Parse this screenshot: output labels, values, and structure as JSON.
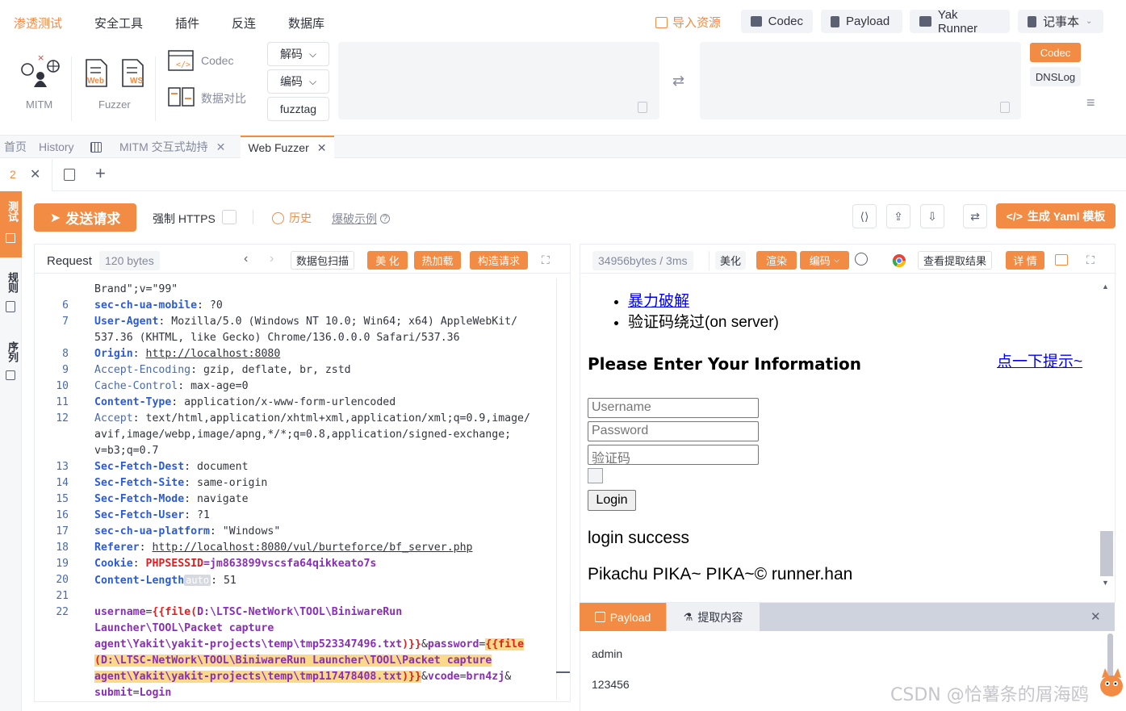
{
  "topnav": {
    "items": [
      "渗透测试",
      "安全工具",
      "插件",
      "反连",
      "数据库"
    ],
    "import_label": "导入资源",
    "buttons": [
      "Codec",
      "Payload",
      "Yak Runner",
      "记事本"
    ]
  },
  "toolbar": {
    "mitm_label": "MITM",
    "fuzzer_label": "Fuzzer",
    "web_label": "Web",
    "ws_label": "WS",
    "codec_label": "Codec",
    "compare_label": "数据对比",
    "decode_label": "解码",
    "encode_label": "编码",
    "fuzztag_label": "fuzztag",
    "right_tabs": [
      "Codec",
      "DNSLog"
    ]
  },
  "page_tabs": [
    "首页",
    "History",
    "MITM 交互式劫持",
    "Web Fuzzer"
  ],
  "sub_tab": {
    "number": "2"
  },
  "left_strip": [
    "测试",
    "规则",
    "序列"
  ],
  "actions": {
    "send": "发送请求",
    "force_https": "强制 HTTPS",
    "history": "历史",
    "brute_example": "爆破示例",
    "yaml": "生成 Yaml 模板"
  },
  "request": {
    "title": "Request",
    "size": "120 bytes",
    "buttons": [
      "数据包扫描",
      "美 化",
      "热加载",
      "构造请求"
    ],
    "lines": [
      {
        "n": "",
        "segs": [
          {
            "t": "Brand\";v=\"99\""
          }
        ]
      },
      {
        "n": "6",
        "segs": [
          {
            "t": "sec-ch-ua-mobile",
            "c": "k"
          },
          {
            "t": ": ?0"
          }
        ]
      },
      {
        "n": "7",
        "segs": [
          {
            "t": "User-Agent",
            "c": "k"
          },
          {
            "t": ": Mozilla/5.0 (Windows NT 10.0; Win64; x64) AppleWebKit/"
          }
        ]
      },
      {
        "n": "",
        "segs": [
          {
            "t": "537.36 (KHTML, like Gecko) Chrome/136.0.0.0 Safari/537.36"
          }
        ]
      },
      {
        "n": "8",
        "segs": [
          {
            "t": "Origin",
            "c": "k"
          },
          {
            "t": ": "
          },
          {
            "t": "http://localhost:8080",
            "c": "ul"
          }
        ]
      },
      {
        "n": "9",
        "segs": [
          {
            "t": "Accept-Encoding",
            "c": "k2"
          },
          {
            "t": ": gzip, deflate, br, zstd"
          }
        ]
      },
      {
        "n": "10",
        "segs": [
          {
            "t": "Cache-Control",
            "c": "k2"
          },
          {
            "t": ": max-age=0"
          }
        ]
      },
      {
        "n": "11",
        "segs": [
          {
            "t": "Content-Type",
            "c": "k"
          },
          {
            "t": ": application/x-www-form-urlencoded"
          }
        ]
      },
      {
        "n": "12",
        "segs": [
          {
            "t": "Accept",
            "c": "k2"
          },
          {
            "t": ": text/html,application/xhtml+xml,application/xml;q=0.9,image/"
          }
        ]
      },
      {
        "n": "",
        "segs": [
          {
            "t": "avif,image/webp,image/apng,*/*;q=0.8,application/signed-exchange;"
          }
        ]
      },
      {
        "n": "",
        "segs": [
          {
            "t": "v=b3;q=0.7"
          }
        ]
      },
      {
        "n": "13",
        "segs": [
          {
            "t": "Sec-Fetch-Dest",
            "c": "k"
          },
          {
            "t": ": document"
          }
        ]
      },
      {
        "n": "14",
        "segs": [
          {
            "t": "Sec-Fetch-Site",
            "c": "k"
          },
          {
            "t": ": same-origin"
          }
        ]
      },
      {
        "n": "15",
        "segs": [
          {
            "t": "Sec-Fetch-Mode",
            "c": "k"
          },
          {
            "t": ": navigate"
          }
        ]
      },
      {
        "n": "16",
        "segs": [
          {
            "t": "Sec-Fetch-User",
            "c": "k"
          },
          {
            "t": ": ?1"
          }
        ]
      },
      {
        "n": "17",
        "segs": [
          {
            "t": "sec-ch-ua-platform",
            "c": "k"
          },
          {
            "t": ": \"Windows\""
          }
        ]
      },
      {
        "n": "18",
        "segs": [
          {
            "t": "Referer",
            "c": "k"
          },
          {
            "t": ": "
          },
          {
            "t": "http://localhost:8080/vul/burteforce/bf_server.php",
            "c": "ul"
          }
        ]
      },
      {
        "n": "19",
        "segs": [
          {
            "t": "Cookie",
            "c": "k"
          },
          {
            "t": ": "
          },
          {
            "t": "PHPSESSID",
            "c": "ph"
          },
          {
            "t": "=jm863899vscsfa64qikkeato7s",
            "c": "sv"
          }
        ]
      },
      {
        "n": "20",
        "segs": [
          {
            "t": "Content-Length",
            "c": "k"
          },
          {
            "t": "auto",
            "c": "tagauto"
          },
          {
            "t": ": 51"
          }
        ]
      },
      {
        "n": "21",
        "segs": [
          {
            "t": ""
          }
        ]
      },
      {
        "n": "22",
        "segs": [
          {
            "t": "username",
            "c": "pk"
          },
          {
            "t": "="
          },
          {
            "t": "{{file(",
            "c": "ph"
          },
          {
            "t": "D:\\LTSC-NetWork\\TOOL\\BiniwareRun",
            "c": "pk"
          }
        ]
      },
      {
        "n": "",
        "segs": [
          {
            "t": "Launcher\\TOOL\\Packet capture",
            "c": "pk"
          }
        ]
      },
      {
        "n": "",
        "segs": [
          {
            "t": "agent\\Yakit\\yakit-projects\\temp\\tmp523347496.txt",
            "c": "pk"
          },
          {
            "t": ")}}",
            "c": "ph"
          },
          {
            "t": "&"
          },
          {
            "t": "password",
            "c": "pk"
          },
          {
            "t": "="
          },
          {
            "t": "{{file",
            "c": "ph hl"
          }
        ]
      },
      {
        "n": "",
        "segs": [
          {
            "t": "(",
            "c": "ph hl"
          },
          {
            "t": "D:\\LTSC-NetWork\\TOOL\\BiniwareRun Launcher\\TOOL\\Packet capture",
            "c": "pk hl"
          }
        ]
      },
      {
        "n": "",
        "segs": [
          {
            "t": "agent\\Yakit\\yakit-projects\\temp\\tmp117478408.txt",
            "c": "pk hl"
          },
          {
            "t": ")}}",
            "c": "ph hl"
          },
          {
            "t": "&"
          },
          {
            "t": "vcode",
            "c": "pk"
          },
          {
            "t": "="
          },
          {
            "t": "brn4zj",
            "c": "sv"
          },
          {
            "t": "&"
          }
        ]
      },
      {
        "n": "",
        "segs": [
          {
            "t": "submit",
            "c": "pk"
          },
          {
            "t": "="
          },
          {
            "t": "Login",
            "c": "sv"
          }
        ]
      }
    ]
  },
  "response": {
    "size": "34956bytes / 3ms",
    "buttons": [
      "美化",
      "渲染",
      "编码",
      "查看提取结果",
      "详 情"
    ],
    "list": [
      "暴力破解",
      "验证码绕过(on server)"
    ],
    "heading": "Please Enter Your Information",
    "hint_link": "点一下提示~",
    "username_ph": "Username",
    "password_ph": "Password",
    "vcode_ph": "验证码",
    "login": "Login",
    "success": "login success",
    "footer": "Pikachu PIKA~ PIKA~© runner.han"
  },
  "payload_panel": {
    "tabs": [
      "Payload",
      "提取内容"
    ],
    "values": [
      "admin",
      "123456"
    ]
  },
  "watermark": "CSDN @恰薯条的屑海鸥",
  "colors": {
    "accent": "#f28b44"
  }
}
